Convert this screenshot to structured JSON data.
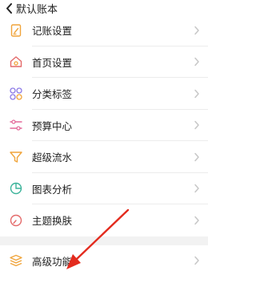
{
  "header": {
    "title": "默认账本"
  },
  "menu": [
    {
      "label": "记账设置",
      "icon": "edit-note-icon"
    },
    {
      "label": "首页设置",
      "icon": "home-icon"
    },
    {
      "label": "分类标签",
      "icon": "category-grid-icon"
    },
    {
      "label": "预算中心",
      "icon": "sliders-icon"
    },
    {
      "label": "超级流水",
      "icon": "funnel-icon"
    },
    {
      "label": "图表分析",
      "icon": "pie-chart-icon"
    },
    {
      "label": "主题换肤",
      "icon": "gauge-icon"
    }
  ],
  "advanced": {
    "label": "高级功能",
    "icon": "layers-icon"
  },
  "colors": {
    "accent": "#f0a43a",
    "annotation_arrow": "#e32b1e",
    "chevron": "#c7c7c7",
    "separator": "#f2f2f2"
  }
}
